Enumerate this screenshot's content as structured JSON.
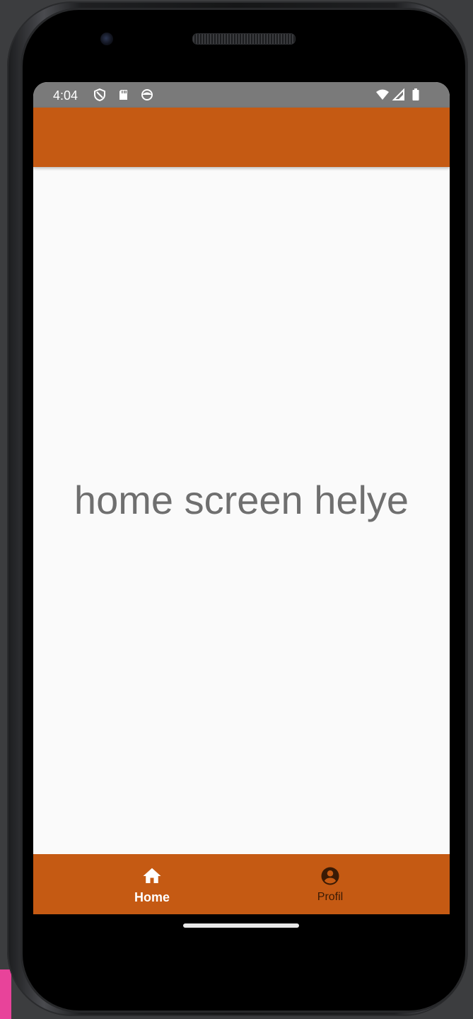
{
  "status_bar": {
    "time": "4:04",
    "left_icons": [
      "shield-icon",
      "sd-card-icon",
      "sync-icon"
    ],
    "right_icons": [
      "wifi-icon",
      "cell-signal-icon",
      "battery-icon"
    ]
  },
  "app_bar": {
    "color": "#c55a13"
  },
  "main": {
    "text": "home screen helye"
  },
  "bottom_nav": {
    "items": [
      {
        "label": "Home",
        "icon": "home-icon",
        "selected": true
      },
      {
        "label": "Profil",
        "icon": "account-circle-icon",
        "selected": false
      }
    ],
    "active_color": "#ffffff",
    "inactive_color": "#3a1a05"
  }
}
